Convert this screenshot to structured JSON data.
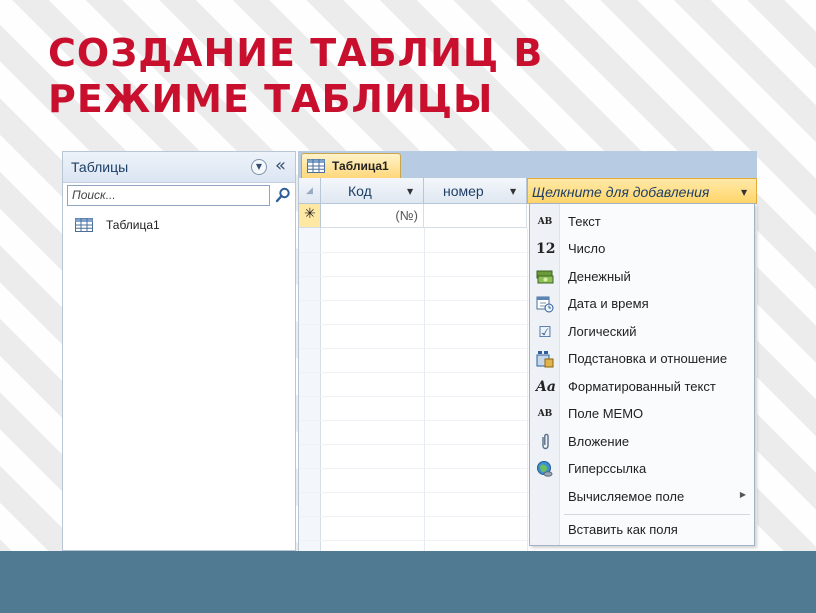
{
  "slide_title": {
    "line1": "СОЗДАНИЕ ТАБЛИЦ В",
    "line2": "РЕЖИМЕ ТАБЛИЦЫ"
  },
  "nav_pane": {
    "title": "Таблицы",
    "collapse_glyph": "«",
    "search_placeholder": "Поиск...",
    "items": [
      {
        "label": "Таблица1",
        "icon": "table-icon"
      }
    ]
  },
  "document": {
    "tab_label": "Таблица1",
    "columns": [
      {
        "label": "Код"
      },
      {
        "label": "номер"
      },
      {
        "label": "Щелкните для добавления"
      }
    ],
    "new_row": {
      "marker": "✳",
      "id_value": "(№)"
    }
  },
  "field_type_menu": {
    "items": [
      {
        "icon_text": "AB",
        "icon": "text-type-icon",
        "label": "Текст"
      },
      {
        "icon_text": "12",
        "icon": "number-type-icon",
        "label": "Число"
      },
      {
        "icon_text": "",
        "icon": "currency-type-icon",
        "label": "Денежный"
      },
      {
        "icon_text": "",
        "icon": "datetime-type-icon",
        "label": "Дата и время"
      },
      {
        "icon_text": "☑",
        "icon": "boolean-type-icon",
        "label": "Логический"
      },
      {
        "icon_text": "",
        "icon": "lookup-type-icon",
        "label": "Подстановка и отношение"
      },
      {
        "icon_text": "Aa",
        "icon": "rich-text-type-icon",
        "label": "Форматированный текст"
      },
      {
        "icon_text": "AB",
        "icon": "memo-type-icon",
        "label": "Поле MEMO"
      },
      {
        "icon_text": "",
        "icon": "attachment-type-icon",
        "label": "Вложение"
      },
      {
        "icon_text": "",
        "icon": "hyperlink-type-icon",
        "label": "Гиперссылка"
      },
      {
        "icon_text": "",
        "icon": "",
        "label": "Вычисляемое поле",
        "has_submenu": true
      },
      {
        "icon_text": "",
        "icon": "",
        "label": "Вставить как поля"
      }
    ]
  },
  "colors": {
    "title_red": "#c8102e",
    "bottom_bar": "#4f7a92",
    "highlight_header": "#ffd56a"
  }
}
